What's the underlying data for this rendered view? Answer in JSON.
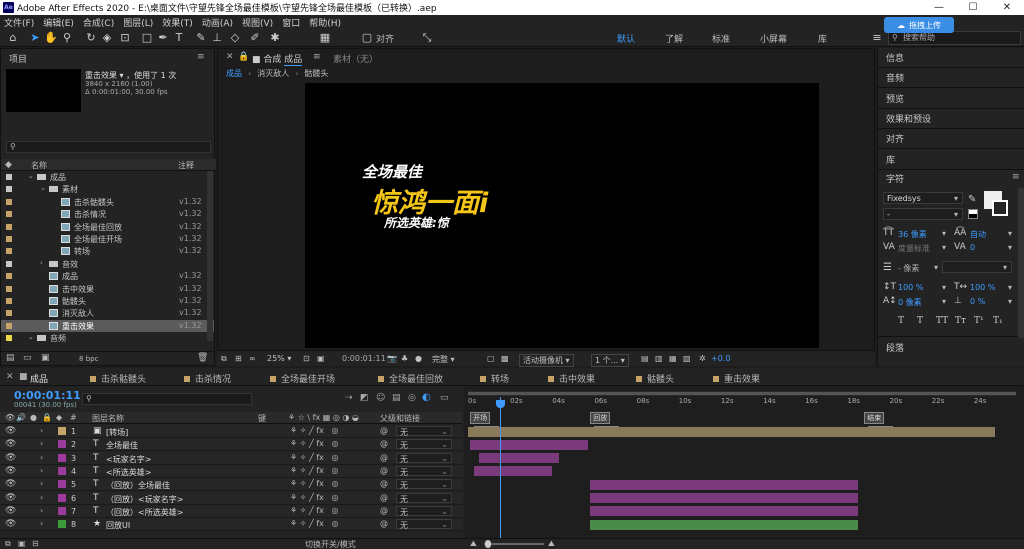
{
  "window": {
    "title": "Adobe After Effects 2020 - E:\\桌面文件\\守望先锋全场最佳模板\\守望先锋全场最佳模板（已转换）.aep",
    "logo_text": "Ae",
    "upload_button": "拖拽上传"
  },
  "menu": [
    "文件(F)",
    "编辑(E)",
    "合成(C)",
    "图层(L)",
    "效果(T)",
    "动画(A)",
    "视图(V)",
    "窗口",
    "帮助(H)"
  ],
  "toolbar": {
    "align_label": "对齐",
    "workspaces": [
      "默认",
      "了解",
      "标准",
      "小屏幕",
      "库"
    ],
    "active_workspace": "默认",
    "search_placeholder": "搜索帮助"
  },
  "project": {
    "title": "项目",
    "selected_name": "重击效果",
    "used_count": "，使用了 1 次",
    "resolution": "3840 x 2160 (1.00)",
    "duration": "Δ 0:00:01:00, 30.00 fps",
    "col_name": "名称",
    "col_comment": "注释",
    "bpc": "8 bpc",
    "rows": [
      {
        "name": "成品",
        "type": "folder",
        "indent": 0,
        "comment": ""
      },
      {
        "name": "素材",
        "type": "folder",
        "indent": 1,
        "comment": ""
      },
      {
        "name": "击杀骷髅头",
        "type": "comp",
        "indent": 2,
        "comment": "v1.32"
      },
      {
        "name": "击杀情况",
        "type": "comp",
        "indent": 2,
        "comment": "v1.32"
      },
      {
        "name": "全场最佳回放",
        "type": "comp",
        "indent": 2,
        "comment": "v1.32"
      },
      {
        "name": "全场最佳开场",
        "type": "comp",
        "indent": 2,
        "comment": "v1.32"
      },
      {
        "name": "转场",
        "type": "comp",
        "indent": 2,
        "comment": "v1.32"
      },
      {
        "name": "音效",
        "type": "folder",
        "indent": 1,
        "comment": ""
      },
      {
        "name": "成品",
        "type": "comp",
        "indent": 1,
        "comment": "v1.32"
      },
      {
        "name": "击中效果",
        "type": "comp",
        "indent": 1,
        "comment": "v1.32"
      },
      {
        "name": "骷髅头",
        "type": "comp",
        "indent": 1,
        "comment": "v1.32"
      },
      {
        "name": "消灭敌人",
        "type": "comp",
        "indent": 1,
        "comment": "v1.32"
      },
      {
        "name": "重击效果",
        "type": "comp",
        "indent": 1,
        "comment": "v1.32",
        "selected": true
      },
      {
        "name": "音频",
        "type": "folder",
        "indent": 0,
        "comment": ""
      }
    ]
  },
  "viewer": {
    "tab_prefix": "合成",
    "tab_name": "成品",
    "footage_tab": "素材（无）",
    "breadcrumbs": [
      "成品",
      "消灭敌人",
      "骷髅头"
    ],
    "overlay": {
      "line1": "全场最佳",
      "line2": "惊鸿一面i",
      "line3": "所选英雄:惊"
    },
    "zoom": "25%",
    "timecode": "0:00:01:11",
    "resolution": "完整",
    "camera": "活动摄像机",
    "views": "1 个...",
    "exposure": "+0.0"
  },
  "right_panels": {
    "items": [
      "信息",
      "音频",
      "预览",
      "效果和预设",
      "对齐",
      "库"
    ],
    "character": {
      "title": "字符",
      "font": "Fixedsys",
      "style": "-",
      "size": "36 像素",
      "leading": "自动",
      "kerning": "度量标准",
      "tracking": "0",
      "stroke": "- 像素",
      "vscale": "100 %",
      "hscale": "100 %",
      "baseline": "0 像素",
      "tsume": "0 %",
      "styles": [
        "T",
        "T",
        "TT",
        "Tт",
        "T¹",
        "T₁"
      ]
    },
    "paragraph": "段落"
  },
  "timeline": {
    "tabs": [
      "成品",
      "击杀骷髅头",
      "击杀情况",
      "全场最佳开场",
      "全场最佳回放",
      "转场",
      "击中效果",
      "骷髅头",
      "重击效果"
    ],
    "timecode": "0:00:01:11",
    "frameinfo": "00041 (30.00 fps)",
    "col_layer": "图层名称",
    "col_key": "键",
    "col_parent": "父级和链接",
    "ruler": [
      "0s",
      "02s",
      "04s",
      "06s",
      "08s",
      "10s",
      "12s",
      "14s",
      "16s",
      "18s",
      "20s",
      "22s",
      "24s"
    ],
    "markers": [
      "开场",
      "回放",
      "结束"
    ],
    "marker_tags": [
      "black",
      "white",
      "black"
    ],
    "layers": [
      {
        "num": "1",
        "type": "comp",
        "name": "[转场]",
        "color": "#c7a36a",
        "parent": "无",
        "bar_start": 0.0,
        "bar_end": 25.0,
        "bar_color": "#8a7a5a"
      },
      {
        "num": "2",
        "type": "text",
        "name": "全场最佳",
        "color": "#9b3c9b",
        "parent": "无",
        "bar_start": 0.1,
        "bar_end": 5.7,
        "bar_color": "#7b3a7b"
      },
      {
        "num": "3",
        "type": "text",
        "name": "<玩家名字>",
        "color": "#9b3c9b",
        "parent": "无",
        "bar_start": 0.5,
        "bar_end": 4.3,
        "bar_color": "#7b3a7b"
      },
      {
        "num": "4",
        "type": "text",
        "name": "<所选英雄>",
        "color": "#9b3c9b",
        "parent": "无",
        "bar_start": 0.3,
        "bar_end": 4.0,
        "bar_color": "#7b3a7b"
      },
      {
        "num": "5",
        "type": "text",
        "name": "（回放）全场最佳",
        "color": "#9b3c9b",
        "parent": "无",
        "bar_start": 5.8,
        "bar_end": 18.5,
        "bar_color": "#7b3a7b"
      },
      {
        "num": "6",
        "type": "text",
        "name": "（回放）<玩家名字>",
        "color": "#9b3c9b",
        "parent": "无",
        "bar_start": 5.8,
        "bar_end": 18.5,
        "bar_color": "#7b3a7b"
      },
      {
        "num": "7",
        "type": "text",
        "name": "（回放）<所选英雄>",
        "color": "#9b3c9b",
        "parent": "无",
        "bar_start": 5.8,
        "bar_end": 18.5,
        "bar_color": "#7b3a7b"
      },
      {
        "num": "8",
        "type": "shape",
        "name": "回放UI",
        "color": "#3c9b3c",
        "parent": "无",
        "bar_start": 5.8,
        "bar_end": 18.5,
        "bar_color": "#4a8a4a"
      }
    ],
    "bottom_toggle": "切换开关/模式"
  },
  "colors": {
    "accent": "#3e9cff",
    "overlay_yellow": "#f5c518",
    "selection": "#5b5b5b"
  }
}
